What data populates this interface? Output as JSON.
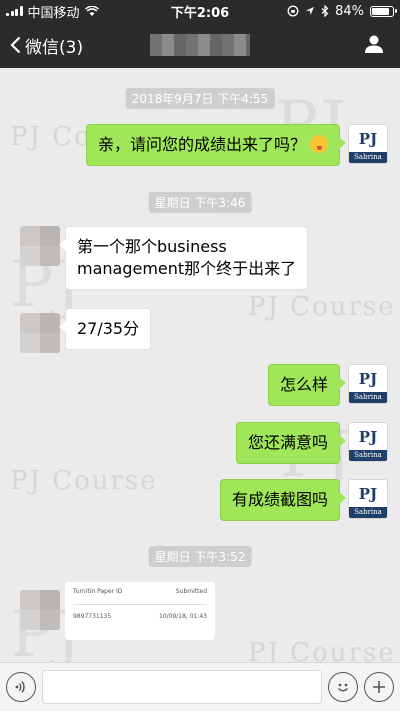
{
  "status_bar": {
    "carrier": "中国移动",
    "time": "下午2:06",
    "battery": "84%",
    "battery_level": 0.84
  },
  "nav": {
    "back_label": "微信(3)",
    "back_icon": "chevron-left-icon",
    "profile_icon": "person-icon"
  },
  "watermark": {
    "brand": "PJ Course",
    "big": "PJ"
  },
  "messages": [
    {
      "type": "timestamp",
      "text": "2018年9月7日 下午4:55"
    },
    {
      "type": "text",
      "from": "me",
      "text": "亲，请问您的成绩出来了吗？",
      "emoji": "tongue-out-emoji"
    },
    {
      "type": "timestamp",
      "text": "星期日 下午3:46"
    },
    {
      "type": "text",
      "from": "other",
      "lines": [
        "第一个那个business",
        "management那个终于出来了"
      ]
    },
    {
      "type": "text",
      "from": "other",
      "text": "27/35分"
    },
    {
      "type": "text",
      "from": "me",
      "text": "怎么样"
    },
    {
      "type": "text",
      "from": "me",
      "text": "您还满意吗"
    },
    {
      "type": "text",
      "from": "me",
      "text": "有成绩截图吗"
    },
    {
      "type": "timestamp",
      "text": "星期日 下午3:52"
    },
    {
      "type": "image",
      "from": "other",
      "header": [
        "Turnitin Paper ID",
        "Submitted"
      ],
      "row": [
        "9897731135",
        "10/09/18, 01:43"
      ]
    }
  ],
  "my_avatar": {
    "top": "PJ",
    "bottom": "Sabrina"
  },
  "input_bar": {
    "voice_icon": "voice-icon",
    "emoji_icon": "emoji-icon",
    "plus_icon": "plus-icon"
  },
  "colors": {
    "bar_bg": "#2b2b2b",
    "chat_bg": "#ebebeb",
    "my_bubble": "#9fe658",
    "other_bubble": "#ffffff",
    "avatar_brand": "#1f3f6d"
  }
}
